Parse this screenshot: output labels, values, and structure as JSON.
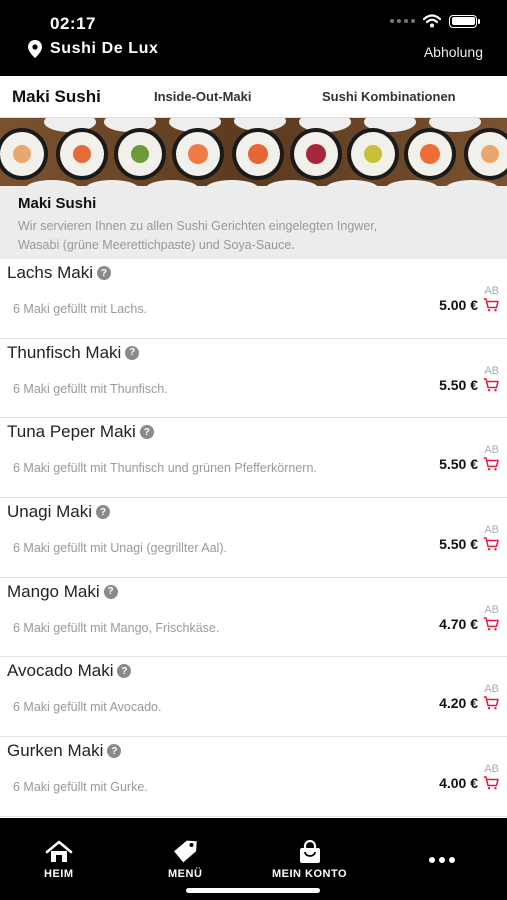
{
  "status": {
    "time": "02:17"
  },
  "header": {
    "restaurant": "Sushi De Lux",
    "mode": "Abholung"
  },
  "tabs": [
    {
      "label": "Maki Sushi",
      "active": true
    },
    {
      "label": "Inside-Out-Maki",
      "active": false
    },
    {
      "label": "Sushi Kombinationen",
      "active": false
    }
  ],
  "category": {
    "title": "Maki Sushi",
    "description_line1": "Wir servieren Ihnen zu allen Sushi Gerichten eingelegten Ingwer,",
    "description_line2": "Wasabi (grüne Meerettichpaste) und Soya-Sauce."
  },
  "items": [
    {
      "name": "Lachs Maki",
      "description": "6 Maki gefüllt mit Lachs.",
      "ab": "AB",
      "price": "5.00 €"
    },
    {
      "name": "Thunfisch Maki",
      "description": "6 Maki gefüllt mit Thunfisch.",
      "ab": "AB",
      "price": "5.50 €"
    },
    {
      "name": "Tuna Peper Maki",
      "description": "6 Maki gefüllt mit Thunfisch und grünen Pfefferkörnern.",
      "ab": "AB",
      "price": "5.50 €"
    },
    {
      "name": "Unagi Maki",
      "description": "6 Maki gefüllt mit Unagi (gegrillter Aal).",
      "ab": "AB",
      "price": "5.50 €"
    },
    {
      "name": "Mango Maki",
      "description": "6 Maki gefüllt mit Mango, Frischkäse.",
      "ab": "AB",
      "price": "4.70 €"
    },
    {
      "name": "Avocado Maki",
      "description": "6 Maki gefüllt mit Avocado.",
      "ab": "AB",
      "price": "4.20 €"
    },
    {
      "name": "Gurken Maki",
      "description": "6 Maki gefüllt mit Gurke.",
      "ab": "AB",
      "price": "4.00 €"
    }
  ],
  "bottom_nav": [
    {
      "label": "HEIM",
      "icon": "home-icon"
    },
    {
      "label": "MENÜ",
      "icon": "tag-icon"
    },
    {
      "label": "MEIN KONTO",
      "icon": "bag-icon"
    },
    {
      "label": "",
      "icon": "more-icon"
    }
  ],
  "colors": {
    "accent": "#d81e3a",
    "bar": "#000000"
  }
}
